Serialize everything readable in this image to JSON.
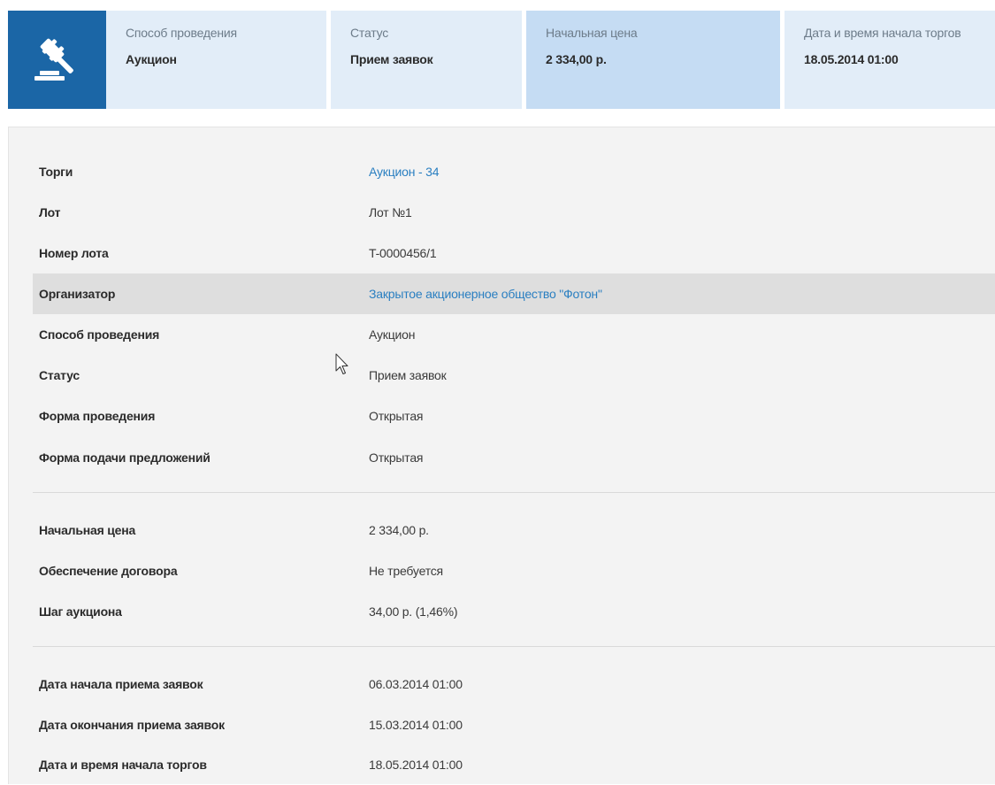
{
  "summary": {
    "icon": "gavel-icon",
    "cells": [
      {
        "label": "Способ проведения",
        "value": "Аукцион"
      },
      {
        "label": "Статус",
        "value": "Прием заявок"
      },
      {
        "label": "Начальная цена",
        "value": "2 334,00 р."
      },
      {
        "label": "Дата и время начала торгов",
        "value": "18.05.2014 01:00"
      }
    ]
  },
  "details": {
    "group1": [
      {
        "key": "Торги",
        "value": "Аукцион - 34"
      },
      {
        "key": "Лот",
        "value": "Лот №1"
      },
      {
        "key": "Номер лота",
        "value": "T-0000456/1"
      },
      {
        "key": "Организатор",
        "value": "Закрытое акционерное общество \"Фотон\""
      },
      {
        "key": "Способ проведения",
        "value": "Аукцион"
      },
      {
        "key": "Статус",
        "value": "Прием заявок"
      },
      {
        "key": "Форма проведения",
        "value": "Открытая"
      },
      {
        "key": "Форма подачи предложений",
        "value": "Открытая"
      }
    ],
    "group2": [
      {
        "key": "Начальная цена",
        "value": "2 334,00 р."
      },
      {
        "key": "Обеспечение договора",
        "value": "Не требуется"
      },
      {
        "key": "Шаг аукциона",
        "value": "34,00 р. (1,46%)"
      }
    ],
    "group3": [
      {
        "key": "Дата начала приема заявок",
        "value": "06.03.2014 01:00"
      },
      {
        "key": "Дата окончания приема заявок",
        "value": "15.03.2014 01:00"
      },
      {
        "key": "Дата и время начала торгов",
        "value": "18.05.2014 01:00"
      }
    ]
  },
  "colors": {
    "brand_blue": "#1b66a6",
    "tile_light": "#e2edf8",
    "tile_highlight": "#c5dcf3",
    "link": "#2a7fc1",
    "panel_bg": "#f3f3f3",
    "row_highlight": "#dedede"
  }
}
